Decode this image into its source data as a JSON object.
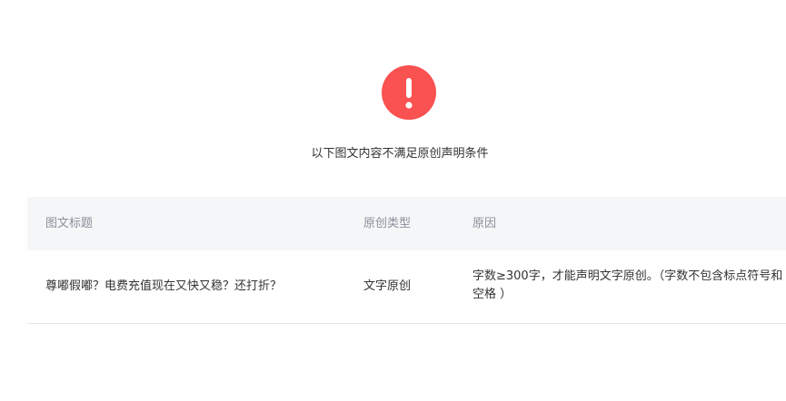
{
  "colors": {
    "alert": "#fa5151",
    "header_bg": "#f5f6f8",
    "header_text": "#8a8f99",
    "body_text": "#333333",
    "divider": "#e7e8eb"
  },
  "icons": {
    "alert": "exclamation-circle-icon"
  },
  "message": "以下图文内容不满足原创声明条件",
  "table": {
    "headers": {
      "title": "图文标题",
      "type": "原创类型",
      "reason": "原因"
    },
    "rows": [
      {
        "title": "尊嘟假嘟？电费充值现在又快又稳？还打折？",
        "type": "文字原创",
        "reason": "字数≥300字，才能声明文字原创。（字数不包含标点符号和空格 ）"
      }
    ]
  }
}
